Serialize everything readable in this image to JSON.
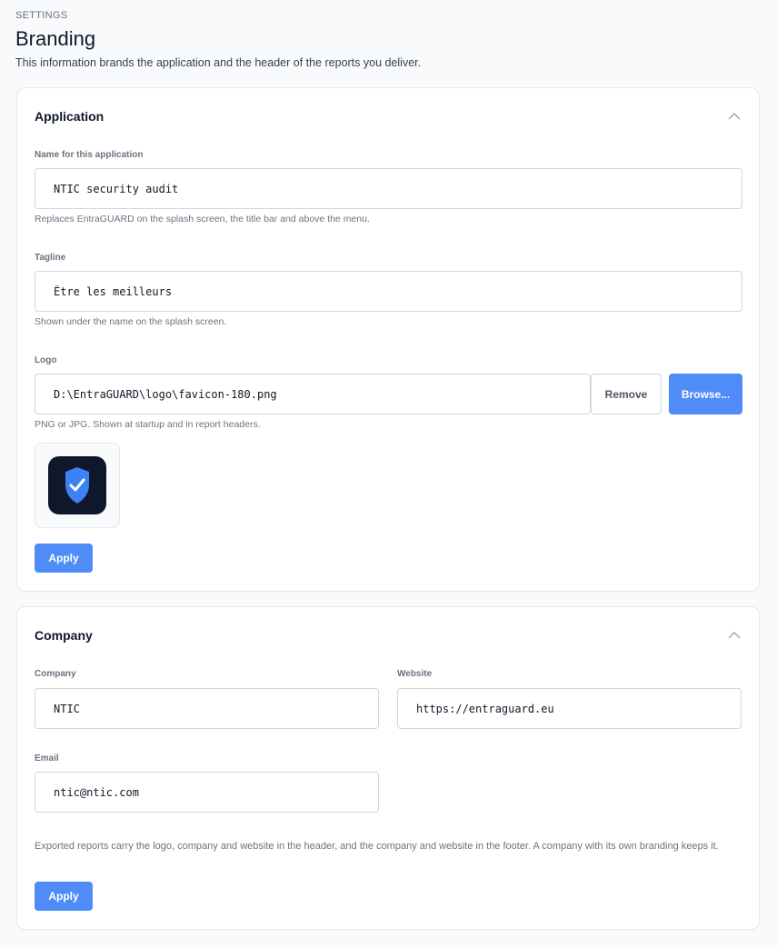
{
  "header": {
    "eyebrow": "SETTINGS",
    "title": "Branding",
    "description": "This information brands the application and the header of the reports you deliver."
  },
  "application": {
    "title": "Application",
    "collapse_icon": "chevron-up-icon",
    "name_field": {
      "label": "Name for this application",
      "value": "NTIC security audit",
      "help": "Replaces EntraGUARD on the splash screen, the title bar and above the menu."
    },
    "tagline_field": {
      "label": "Tagline",
      "value": "Être les meilleurs",
      "help": "Shown under the name on the splash screen."
    },
    "logo_field": {
      "label": "Logo",
      "value": "D:\\EntraGUARD\\logo\\favicon-180.png",
      "remove_label": "Remove",
      "browse_label": "Browse...",
      "help": "PNG or JPG. Shown at startup and in report headers.",
      "preview_icon": "shield-check-icon"
    },
    "apply_label": "Apply"
  },
  "company": {
    "title": "Company",
    "collapse_icon": "chevron-up-icon",
    "company_field": {
      "label": "Company",
      "value": "NTIC"
    },
    "website_field": {
      "label": "Website",
      "value": "https://entraguard.eu"
    },
    "email_field": {
      "label": "Email",
      "value": "ntic@ntic.com"
    },
    "note": "Exported reports carry the logo, company and website in the header, and the company and website in the footer. A company with its own branding keeps it.",
    "apply_label": "Apply"
  },
  "colors": {
    "primary": "#4f8cf7",
    "page_background": "#f8fafc",
    "logo_tile": "#0f172a",
    "shield": "#3b82f6"
  }
}
